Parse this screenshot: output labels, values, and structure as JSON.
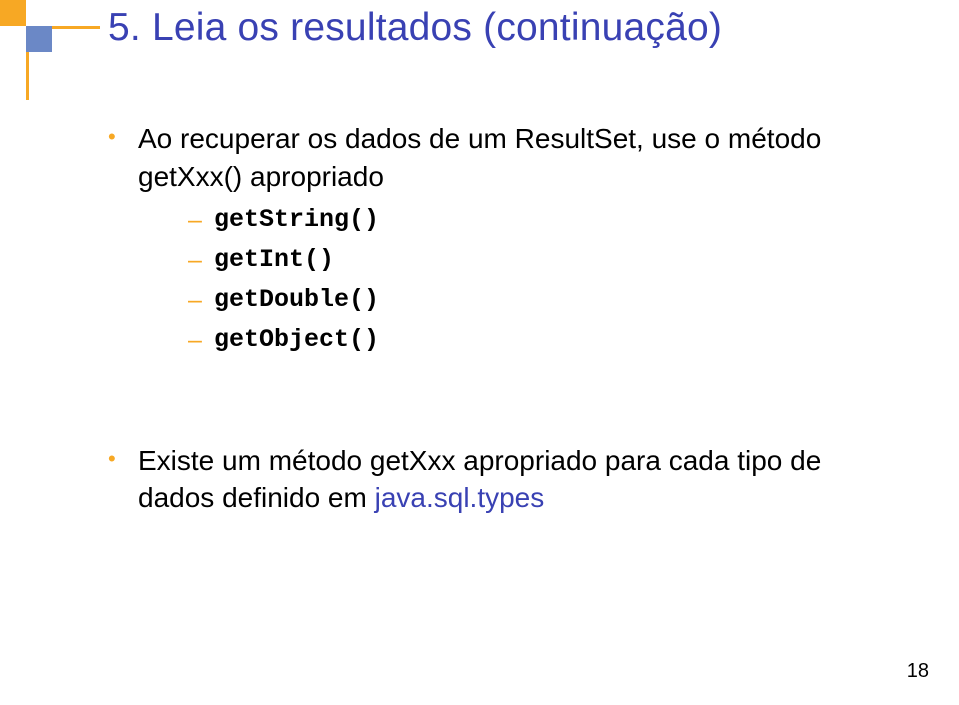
{
  "title": "5. Leia os resultados (continuação)",
  "intro_l1": "Ao recuperar os dados de um ResultSet, use o método",
  "intro_l2": "getXxx() apropriado",
  "methods": {
    "m0": "getString()",
    "m1": "getInt()",
    "m2": "getDouble()",
    "m3": "getObject()"
  },
  "note_pre": "Existe um método getXxx apropriado para cada tipo de dados definido em ",
  "note_link": "java.sql.types",
  "page": "18"
}
